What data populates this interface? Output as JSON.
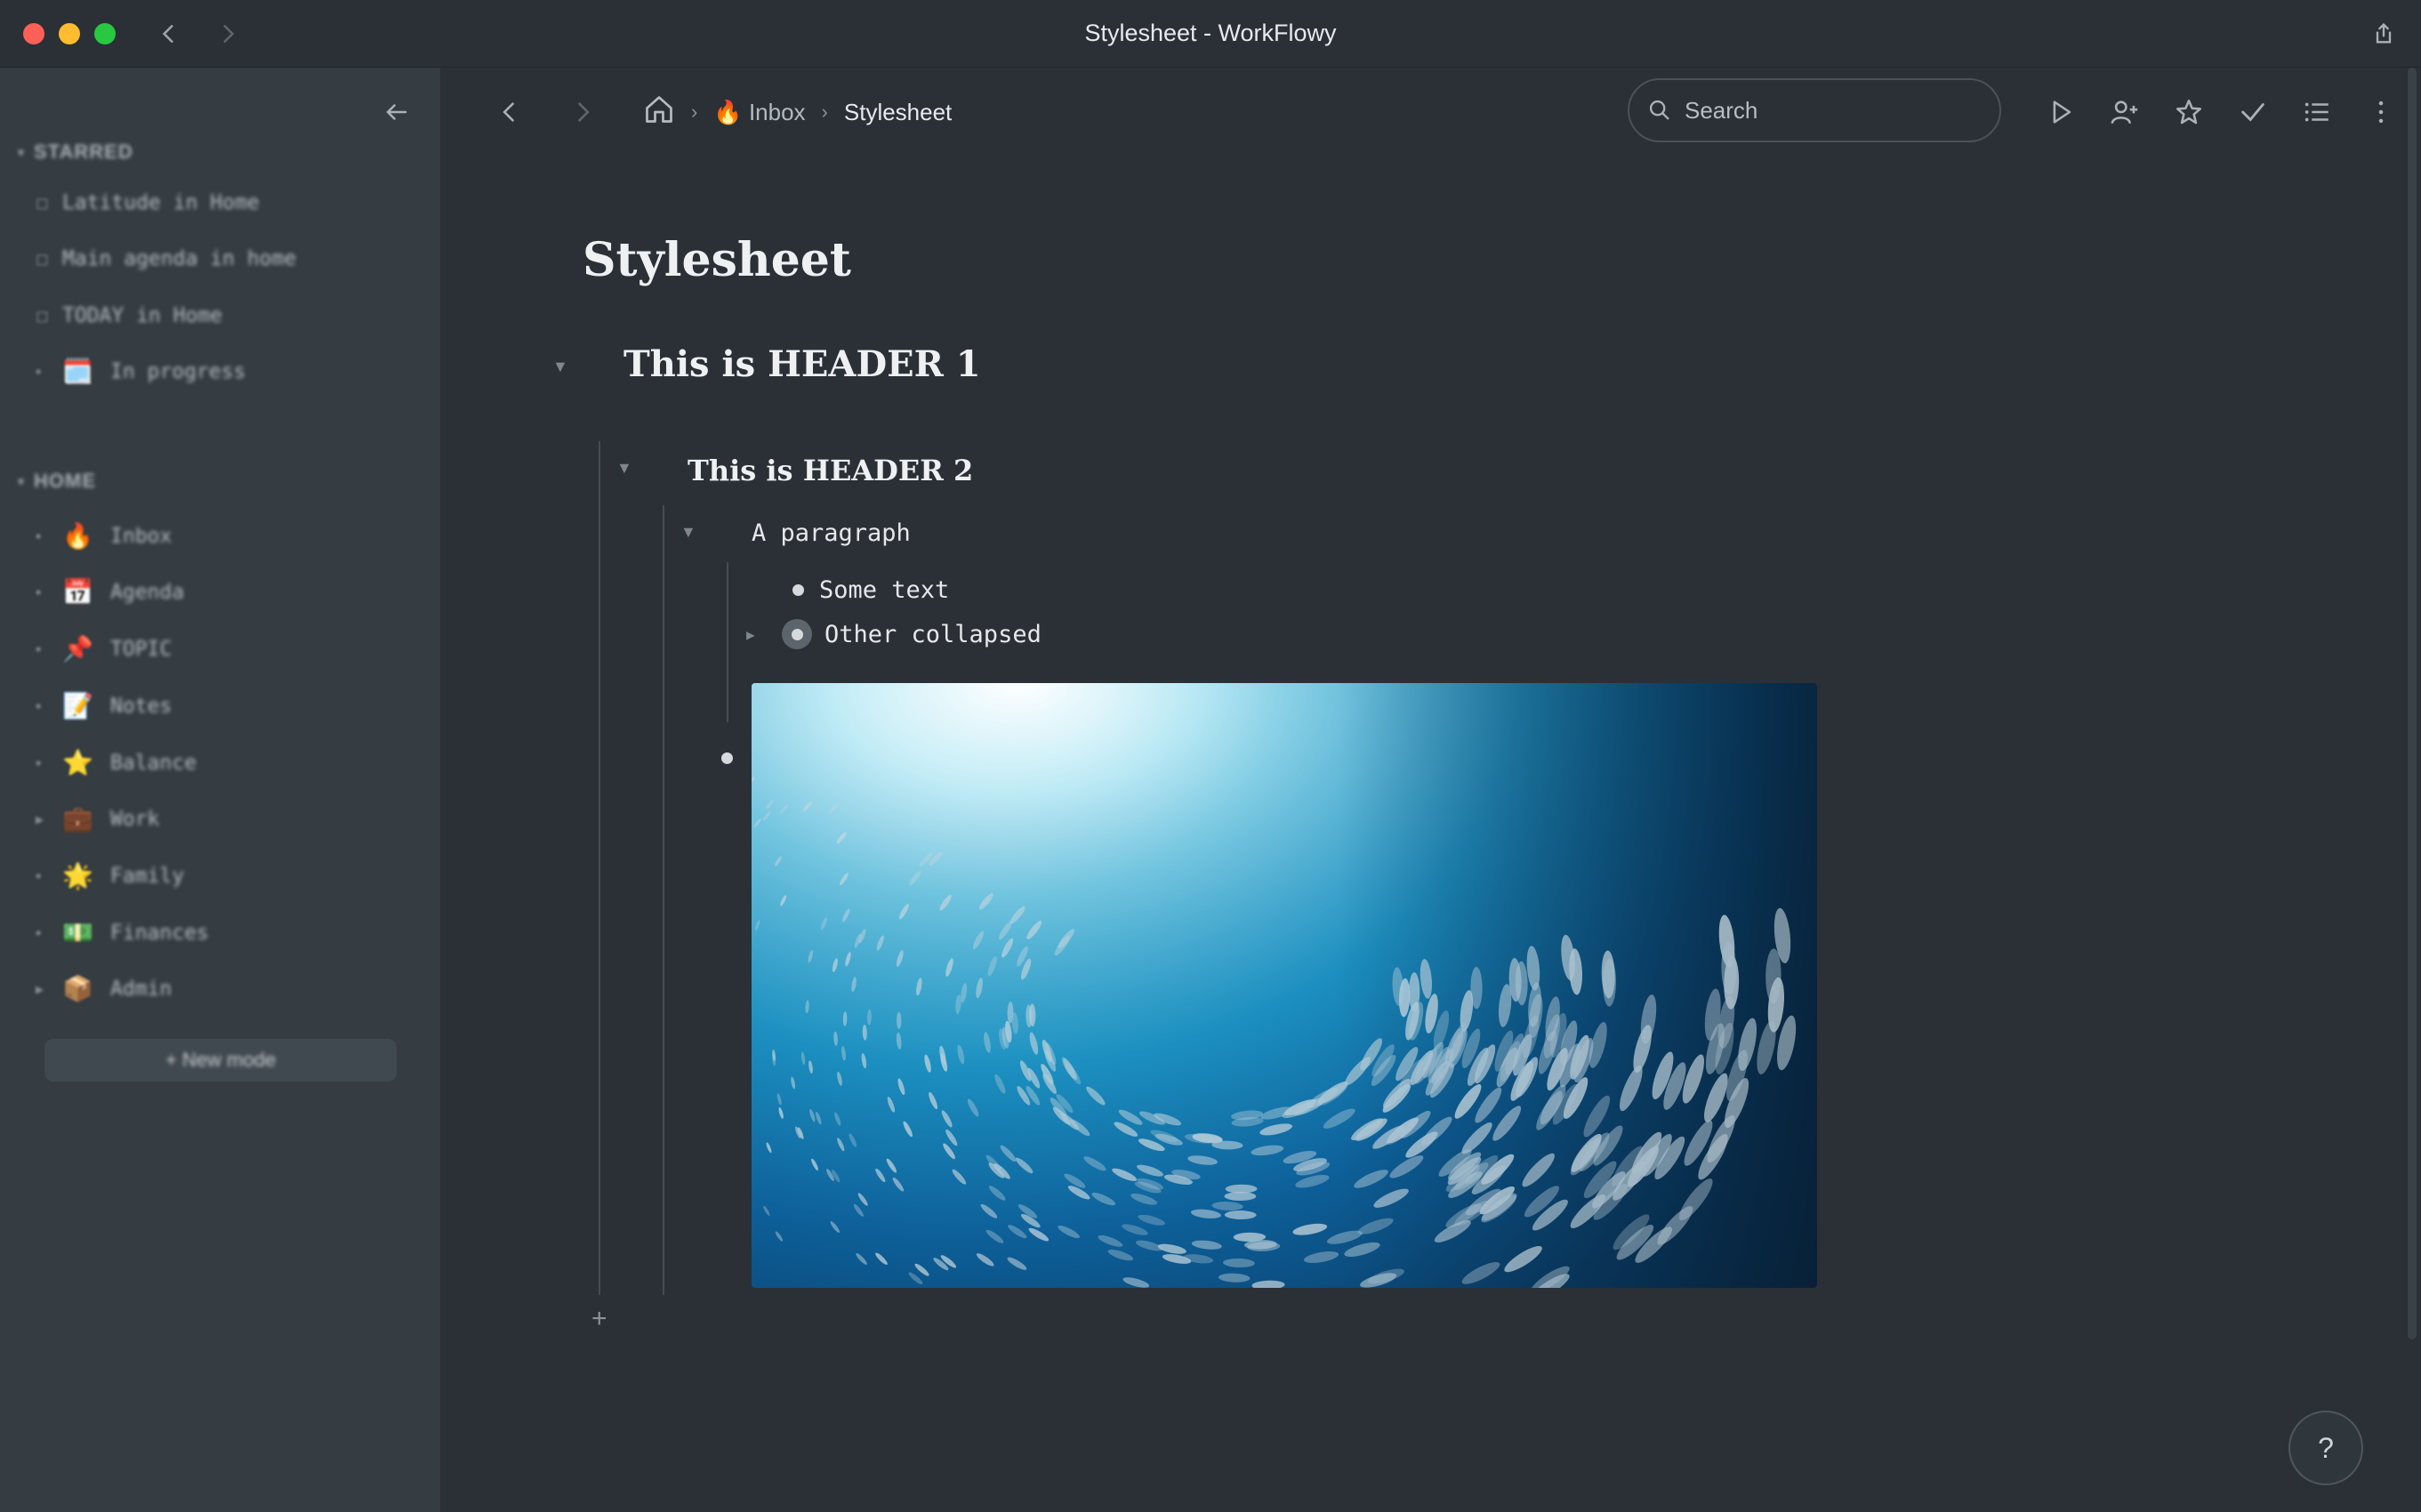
{
  "window": {
    "title": "Stylesheet - WorkFlowy"
  },
  "sidebar": {
    "sections": [
      {
        "title": "STARRED",
        "items": [
          {
            "icon": "",
            "label": "Latitude in Home"
          },
          {
            "icon": "",
            "label": "Main agenda in home"
          },
          {
            "icon": "",
            "label": "TODAY in Home"
          },
          {
            "icon": "🗓️",
            "label": "In progress"
          }
        ]
      },
      {
        "title": "HOME",
        "items": [
          {
            "icon": "🔥",
            "label": "Inbox"
          },
          {
            "icon": "📅",
            "label": "Agenda"
          },
          {
            "icon": "📌",
            "label": "TOPIC"
          },
          {
            "icon": "📝",
            "label": "Notes"
          },
          {
            "icon": "⭐",
            "label": "Balance"
          },
          {
            "icon": "💼",
            "label": "Work"
          },
          {
            "icon": "🌟",
            "label": "Family"
          },
          {
            "icon": "💵",
            "label": "Finances"
          },
          {
            "icon": "📦",
            "label": "Admin"
          }
        ]
      }
    ],
    "new_mode_label": "+ New mode"
  },
  "toolbar": {
    "breadcrumb": {
      "inbox_icon": "🔥",
      "inbox_label": "Inbox",
      "current": "Stylesheet"
    },
    "search_placeholder": "Search"
  },
  "document": {
    "title": "Stylesheet",
    "header1": "This is HEADER 1",
    "header2": "This is HEADER 2",
    "paragraph": "A paragraph",
    "items": [
      {
        "text": "Some text",
        "collapsed": false
      },
      {
        "text": "Other collapsed",
        "collapsed": true
      }
    ],
    "image_item": "underwater school of fish photo"
  },
  "help_label": "?"
}
